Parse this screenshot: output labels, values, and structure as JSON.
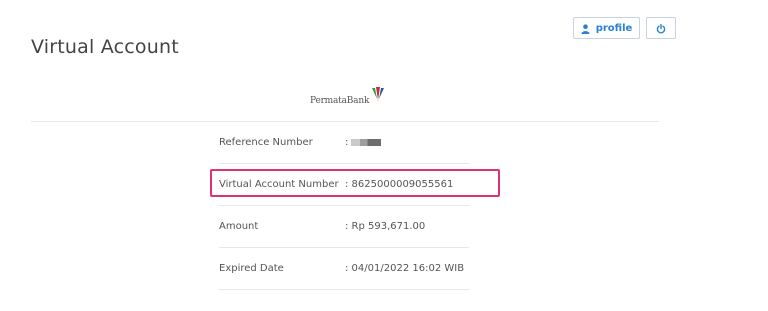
{
  "header": {
    "title": "Virtual Account",
    "profile_label": "profile"
  },
  "bank": {
    "logo_text": "PermataBank",
    "logo_colors": [
      "#2e9d49",
      "#d6252e",
      "#1b5fa8"
    ]
  },
  "details": [
    {
      "label": "Reference Number",
      "value": ":"
    },
    {
      "label": "Virtual Account Number",
      "value": ": 8625000009055561"
    },
    {
      "label": "Amount",
      "value": ": Rp 593,671.00"
    },
    {
      "label": "Expired Date",
      "value": ": 04/01/2022 16:02 WIB"
    }
  ],
  "colors": {
    "accent": "#2a7fd6",
    "highlight": "#e0336b"
  },
  "icons": {
    "profile": "user-icon",
    "power": "power-icon"
  }
}
